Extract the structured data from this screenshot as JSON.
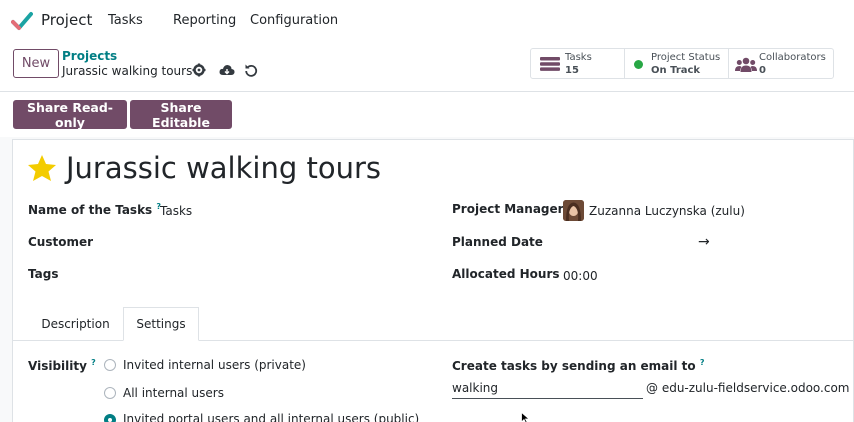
{
  "navbar": {
    "app_name": "Project",
    "menu": [
      "Tasks",
      "Reporting",
      "Configuration"
    ]
  },
  "control_panel": {
    "new_label": "New",
    "breadcrumb_parent": "Projects",
    "breadcrumb_current": "Jurassic walking tours",
    "stats": [
      {
        "label": "Tasks",
        "value": "15",
        "icon": "tasks-icon"
      },
      {
        "label": "Project Status",
        "value": "On Track",
        "icon": "status-dot-icon"
      },
      {
        "label": "Collaborators",
        "value": "0",
        "icon": "users-icon"
      }
    ]
  },
  "actions": {
    "share_readonly": "Share Read-only",
    "share_editable": "Share Editable"
  },
  "form": {
    "title": "Jurassic walking tours",
    "fields": {
      "name_of_tasks_label": "Name of the Tasks",
      "name_of_tasks_value": "Tasks",
      "customer_label": "Customer",
      "tags_label": "Tags",
      "project_manager_label": "Project Manager",
      "project_manager_value": "Zuzanna Luczynska (zulu)",
      "planned_date_label": "Planned Date",
      "planned_date_arrow": "→",
      "allocated_hours_label": "Allocated Hours",
      "allocated_hours_value": "00:00"
    },
    "help_mark": "?"
  },
  "tabs": [
    "Description",
    "Settings"
  ],
  "settings": {
    "visibility_label": "Visibility",
    "visibility_options": [
      "Invited internal users (private)",
      "All internal users",
      "Invited portal users and all internal users (public)"
    ],
    "email_label": "Create tasks by sending an email to",
    "email_alias": "walking",
    "email_domain": "@ edu-zulu-fieldservice.odoo.com"
  },
  "colors": {
    "primary": "#714b67",
    "link": "#017e84",
    "success": "#28a745",
    "star": "#f3cc00"
  }
}
